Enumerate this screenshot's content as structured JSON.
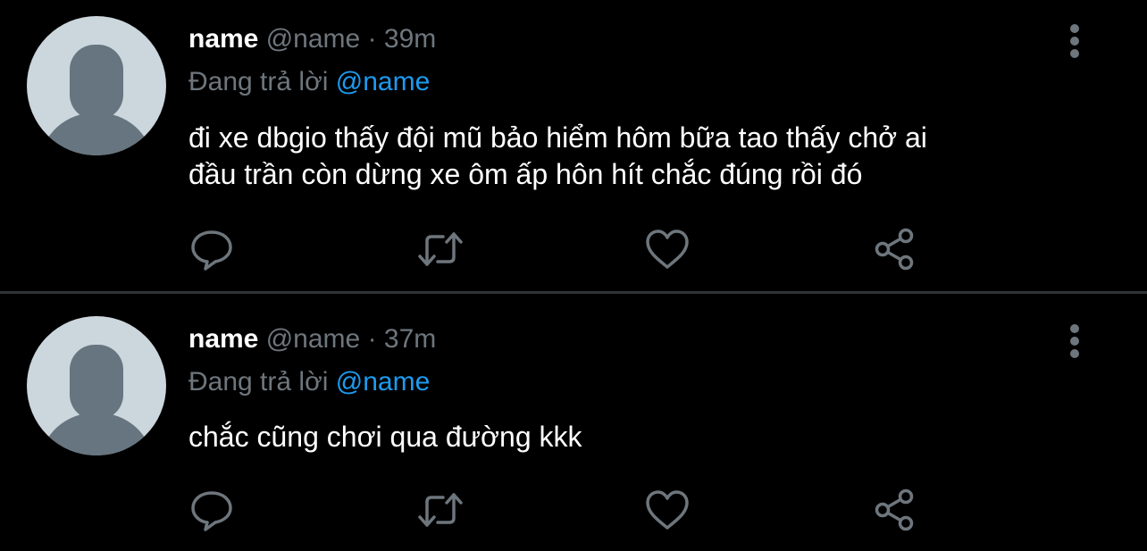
{
  "colors": {
    "background": "#000000",
    "primary_text": "#ffffff",
    "secondary_text": "#6e767d",
    "mention": "#1d9bf0",
    "divider": "#2f3336",
    "avatar_bg": "#ccd6dd",
    "avatar_fg": "#66757f"
  },
  "tweets": [
    {
      "display_name": "name",
      "handle": "@name",
      "separator": "·",
      "time": "39m",
      "replying_label": "Đang trả lời",
      "replying_to": "@name",
      "text_lines": [
        "đi xe dbgio thấy đội mũ bảo hiểm hôm bữa tao thấy chở ai",
        "đầu trần còn dừng xe ôm ấp hôn hít chắc đúng rồi đó"
      ],
      "actions": [
        "reply-icon",
        "retweet-icon",
        "like-icon",
        "share-icon"
      ],
      "menu_icon": "more-vertical-icon"
    },
    {
      "display_name": "name",
      "handle": "@name",
      "separator": "·",
      "time": "37m",
      "replying_label": "Đang trả lời",
      "replying_to": "@name",
      "text_lines": [
        "chắc cũng chơi qua đường kkk"
      ],
      "actions": [
        "reply-icon",
        "retweet-icon",
        "like-icon",
        "share-icon"
      ],
      "menu_icon": "more-vertical-icon"
    }
  ]
}
